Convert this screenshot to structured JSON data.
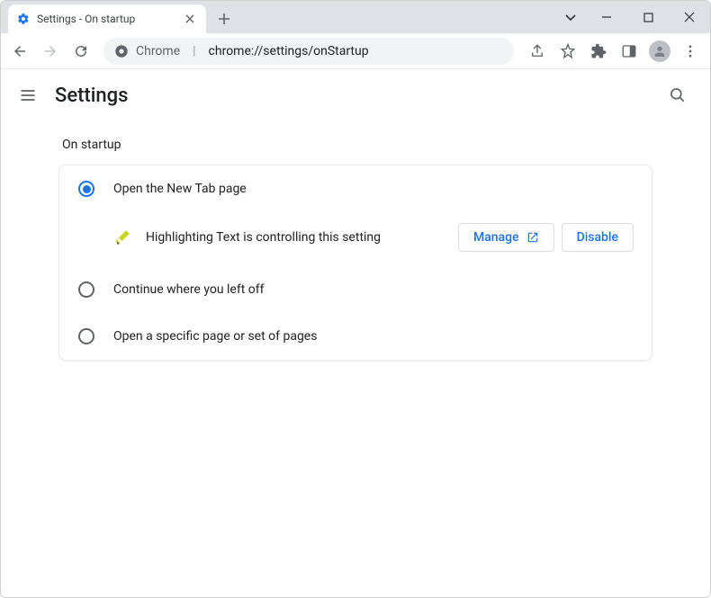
{
  "tab": {
    "title": "Settings - On startup"
  },
  "omnibox": {
    "scheme": "Chrome",
    "url": "chrome://settings/onStartup"
  },
  "header": {
    "title": "Settings"
  },
  "section": {
    "title": "On startup",
    "options": [
      {
        "label": "Open the New Tab page",
        "selected": true
      },
      {
        "label": "Continue where you left off",
        "selected": false
      },
      {
        "label": "Open a specific page or set of pages",
        "selected": false
      }
    ],
    "controlled": {
      "text": "Highlighting Text is controlling this setting",
      "manage_label": "Manage",
      "disable_label": "Disable"
    }
  }
}
